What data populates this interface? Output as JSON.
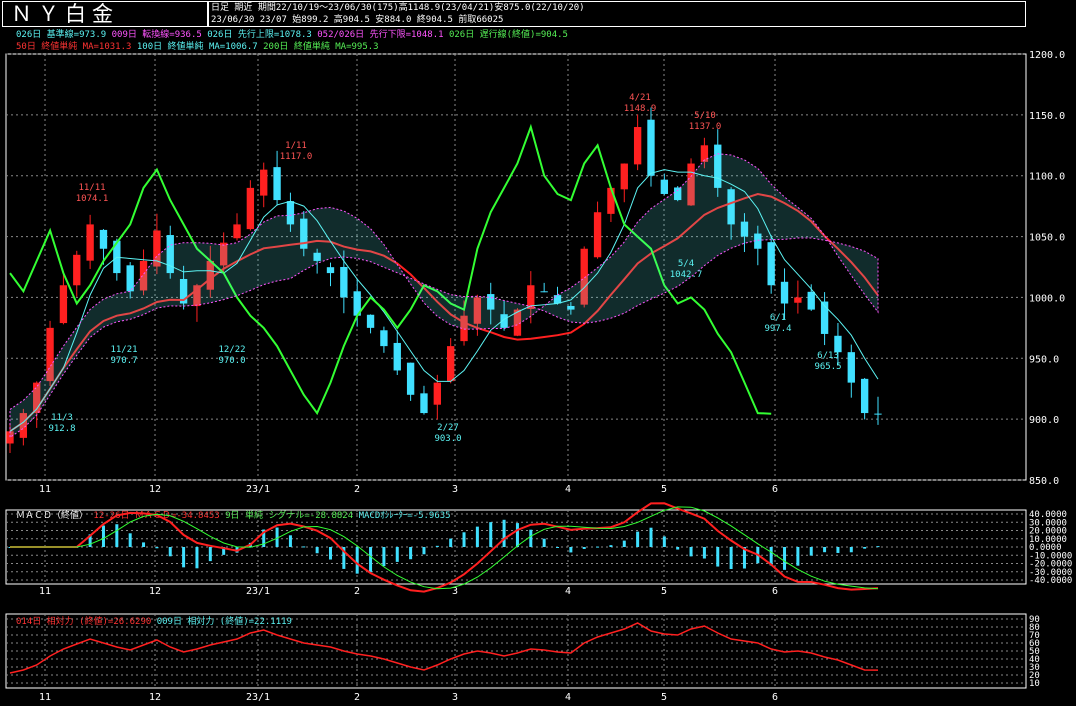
{
  "title": "ＮＹ白金",
  "header": {
    "line1": "日足 期近 期間22/10/19～23/06/30(175)高1148.9(23/04/21)安875.0(22/10/20)",
    "line2": "23/06/30 23/07 始899.2 高904.5 安884.0 終904.5 前取66025"
  },
  "legend_main": {
    "row1": [
      {
        "text": "026日 基準線=973.9",
        "color": "#5cf4f4"
      },
      {
        "text": "009日 転換線=936.5",
        "color": "#ff55ff"
      },
      {
        "text": "026日 先行上限=1078.3",
        "color": "#5cf4f4"
      },
      {
        "text": "052/026日 先行下限=1048.1",
        "color": "#ff55ff"
      },
      {
        "text": "026日 遅行線(終値)=904.5",
        "color": "#55ee55"
      }
    ],
    "row2": [
      {
        "text": "50日 終値単純 MA=1031.3",
        "color": "#ff3333"
      },
      {
        "text": "100日 終値単純 MA=1006.7",
        "color": "#5cf4f4"
      },
      {
        "text": "200日 終値単純 MA=995.3",
        "color": "#55ee55"
      }
    ]
  },
  "legend_macd": [
    {
      "text": "ＭＡＣＤ（終値）",
      "color": "#ffffff"
    },
    {
      "text": "12-26日 ＭＡＣＤ=-34.8453",
      "color": "#ff3333"
    },
    {
      "text": "9日 単純 シグナル=-28.8824",
      "color": "#55ee55"
    },
    {
      "text": "MACDｵｼﾚｰﾀｰ=-5.9635",
      "color": "#5cf4f4"
    }
  ],
  "legend_rsi": [
    {
      "text": "014日 相対力 (終値)=26.6290",
      "color": "#ff3333"
    },
    {
      "text": "009日 相対力 (終値)=22.1119",
      "color": "#5cf4f4"
    }
  ],
  "x_labels": [
    "11",
    "12",
    "23/1",
    "2",
    "3",
    "4",
    "5",
    "6"
  ],
  "y_labels_main": [
    "1200.0",
    "1150.0",
    "1100.0",
    "1050.0",
    "1000.0",
    "950.0",
    "900.0",
    "850.0"
  ],
  "y_labels_macd": [
    "40.0000",
    "30.0000",
    "20.0000",
    "10.0000",
    "0.0000",
    "-10.0000",
    "-20.0000",
    "-30.0000",
    "-40.0000"
  ],
  "y_labels_rsi": [
    "90",
    "80",
    "70",
    "60",
    "50",
    "40",
    "30",
    "20",
    "10"
  ],
  "annotations": [
    {
      "date": "11/11",
      "value": "1074.1"
    },
    {
      "date": "1/11",
      "value": "1117.0"
    },
    {
      "date": "4/21",
      "value": "1148.9"
    },
    {
      "date": "5/10",
      "value": "1137.0"
    },
    {
      "date": "11/21",
      "value": "970.7"
    },
    {
      "date": "12/22",
      "value": "970.0"
    },
    {
      "date": "11/3",
      "value": "912.8"
    },
    {
      "date": "2/27",
      "value": "903.0"
    },
    {
      "date": "5/4",
      "value": "1042.7"
    },
    {
      "date": "6/1",
      "value": "997.4"
    },
    {
      "date": "6/13",
      "value": "965.5"
    }
  ],
  "colors": {
    "up": "#ff2020",
    "down": "#40e0ff",
    "ma50": "#ff2020",
    "kijun": "#5cf4f4",
    "tenkan": "#ff55ff",
    "chikou": "#33ff33",
    "cloud": "#5cf4f4",
    "grid": "#888888"
  },
  "chart_data": {
    "type": "line",
    "title": "ＮＹ白金",
    "x_ticks": [
      "11",
      "12",
      "23/1",
      "2",
      "3",
      "4",
      "5",
      "6"
    ],
    "price_ylim": [
      850,
      1200
    ],
    "price_close_approx": [
      890,
      905,
      930,
      975,
      1010,
      1035,
      1060,
      1040,
      1020,
      1005,
      1030,
      1055,
      1020,
      995,
      1010,
      1030,
      1045,
      1060,
      1090,
      1105,
      1080,
      1060,
      1040,
      1030,
      1020,
      1000,
      985,
      975,
      960,
      940,
      920,
      905,
      930,
      960,
      985,
      1000,
      990,
      975,
      990,
      1010,
      1005,
      995,
      990,
      1040,
      1070,
      1090,
      1110,
      1140,
      1100,
      1085,
      1080,
      1110,
      1125,
      1090,
      1060,
      1050,
      1040,
      1010,
      995,
      1000,
      990,
      970,
      955,
      930,
      905,
      904.5
    ],
    "macd_ylim": [
      -40,
      40
    ],
    "rsi_ylim": [
      10,
      90
    ]
  }
}
